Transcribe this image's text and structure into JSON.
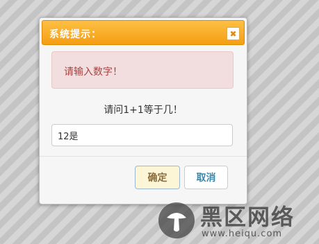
{
  "dialog": {
    "title": "系统提示：",
    "close_icon": "close-icon",
    "alert_message": "请输入数字！",
    "question": "请问1+1等于几！",
    "answer_value": "12是",
    "ok_label": "确定",
    "cancel_label": "取消"
  },
  "watermark": {
    "brand": "黑区网络",
    "url": "www.heiqu.com"
  },
  "colors": {
    "header_orange": "#f5a623",
    "alert_bg": "#f2dede",
    "alert_text": "#a94442",
    "ok_bg": "#fcf6d6",
    "cancel_text": "#3a87ad"
  }
}
